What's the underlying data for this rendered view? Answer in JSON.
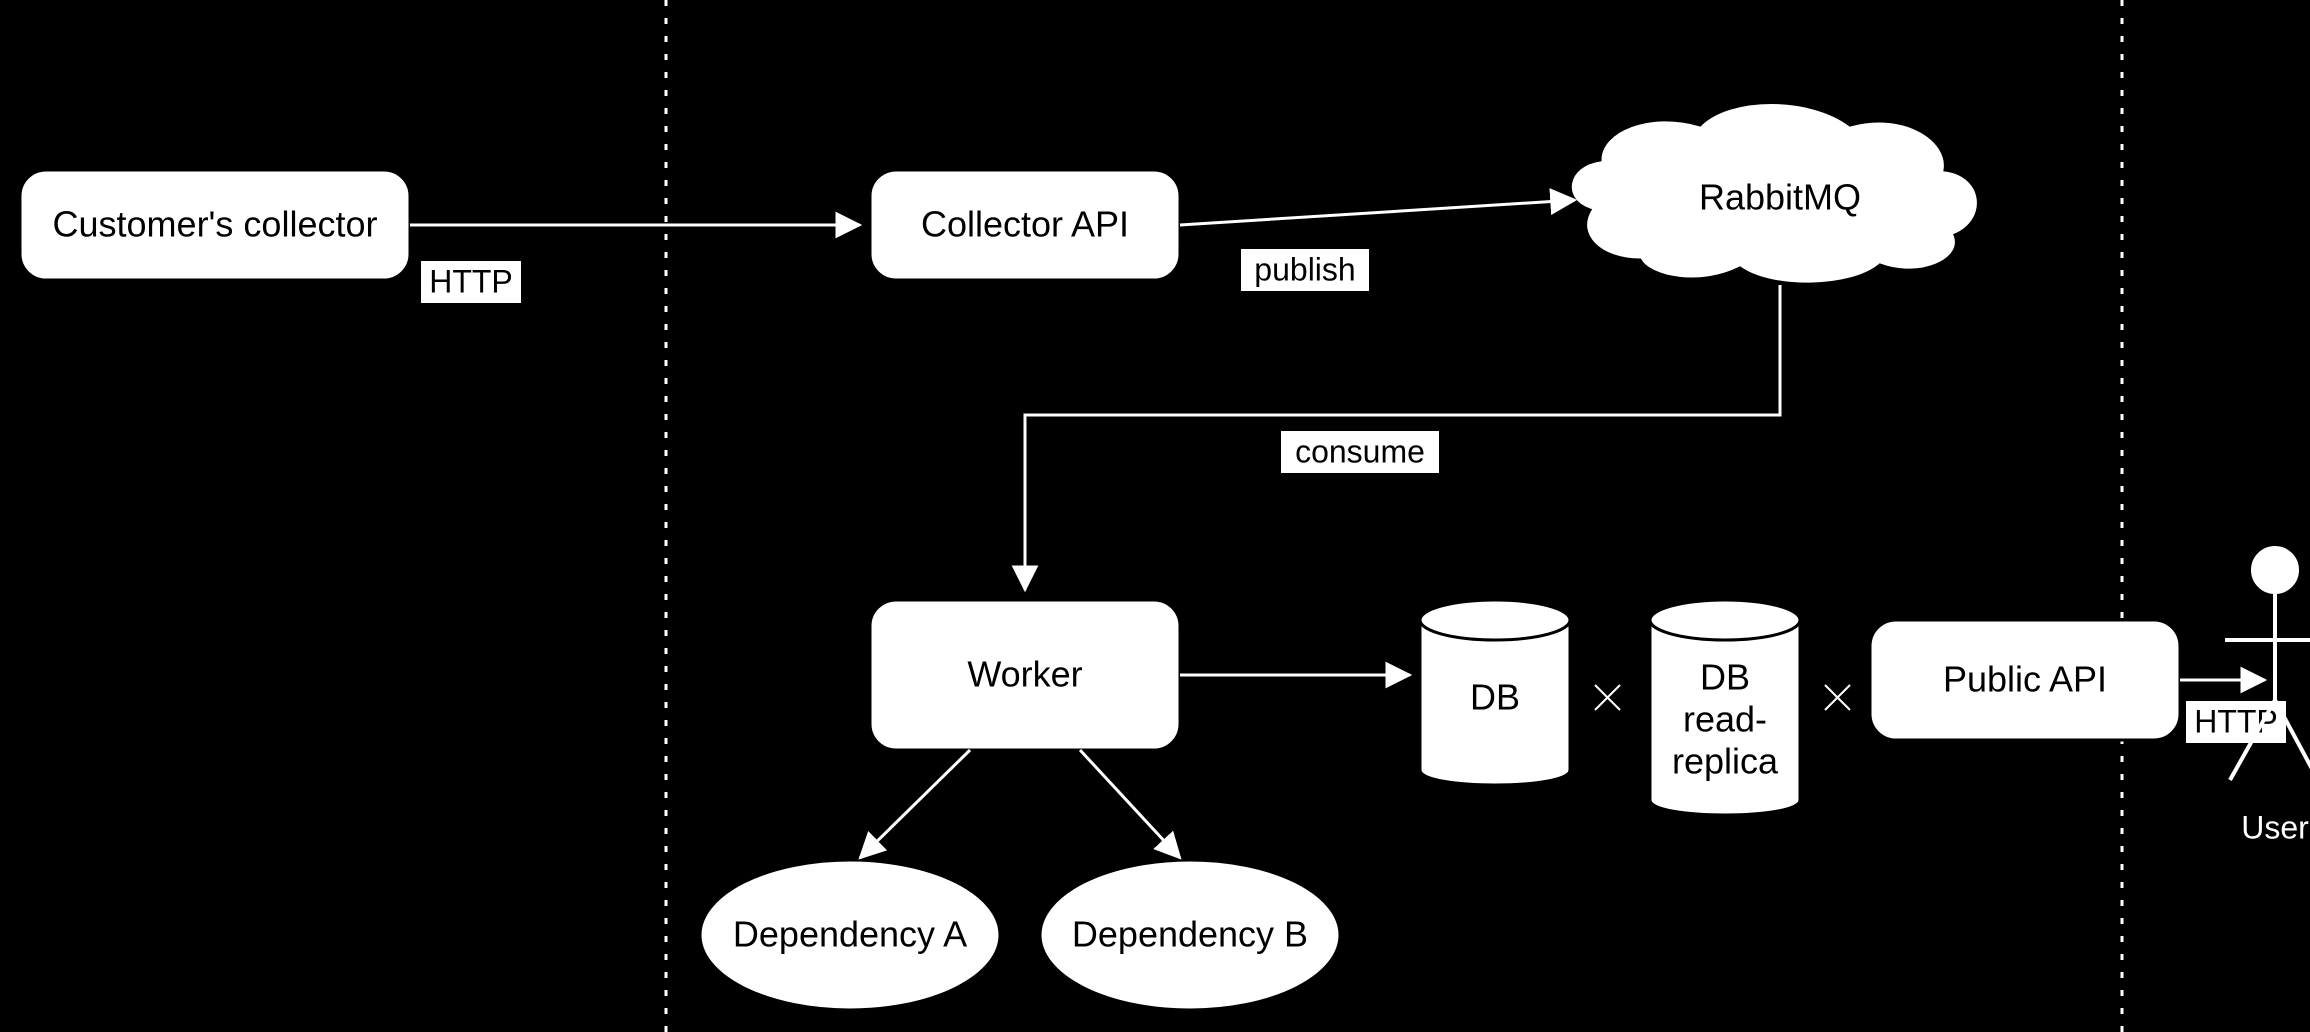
{
  "diagram": {
    "nodes": {
      "customer_collector": {
        "label": "Customer's collector"
      },
      "collector_api": {
        "label": "Collector API"
      },
      "rabbitmq": {
        "label": "RabbitMQ"
      },
      "worker": {
        "label": "Worker"
      },
      "db": {
        "label": "DB"
      },
      "db_replica": {
        "label1": "DB",
        "label2": "read-",
        "label3": "replica"
      },
      "public_api": {
        "label": "Public API"
      },
      "dep_a": {
        "label": "Dependency A"
      },
      "dep_b": {
        "label": "Dependency B"
      },
      "user": {
        "label": "User"
      }
    },
    "edges": {
      "cust_to_collector": {
        "label": "HTTP"
      },
      "collector_to_mq": {
        "label": "publish"
      },
      "mq_to_worker": {
        "label": "consume"
      },
      "public_to_user": {
        "label": "HTTP"
      }
    }
  }
}
